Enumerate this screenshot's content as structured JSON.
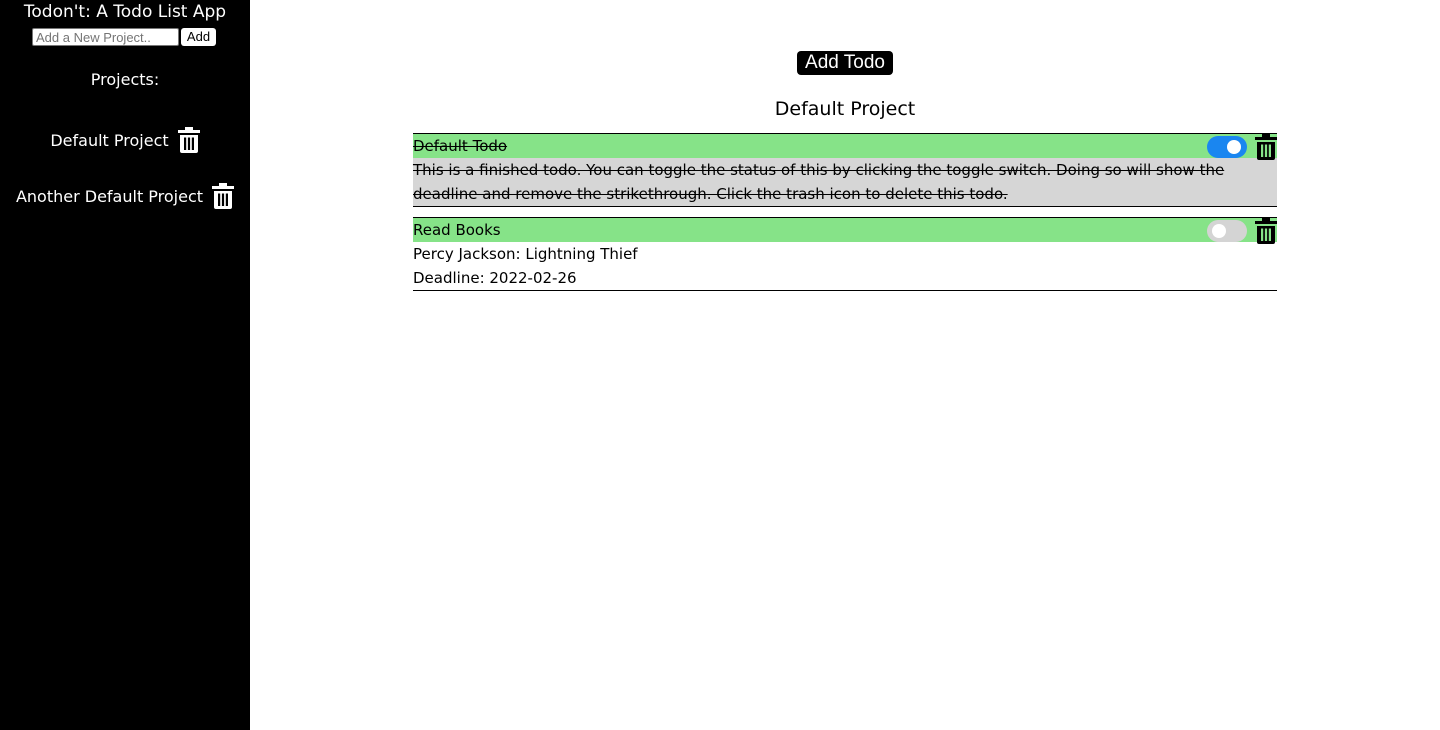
{
  "sidebar": {
    "app_title": "Todon't: A Todo List App",
    "new_project_placeholder": "Add a New Project..",
    "add_button_label": "Add",
    "projects_heading": "Projects:",
    "projects": [
      {
        "name": "Default Project",
        "icon": "trash-icon"
      },
      {
        "name": "Another Default Project",
        "icon": "trash-icon"
      }
    ]
  },
  "main": {
    "add_todo_label": "Add Todo",
    "project_title": "Default Project",
    "todos": [
      {
        "title": "Default Todo",
        "description": "This is a finished todo. You can toggle the status of this by clicking the toggle switch. Doing so will show the deadline and remove the strikethrough. Click the trash icon to delete this todo.",
        "completed": true
      },
      {
        "title": "Read Books",
        "description": "Percy Jackson: Lightning Thief",
        "deadline": "Deadline: 2022-02-26",
        "completed": false
      }
    ]
  },
  "colors": {
    "sidebar_bg": "#000000",
    "todo_header_bg": "#86e388",
    "completed_body_bg": "#d6d6d6",
    "toggle_on": "#1a86f0",
    "toggle_off": "#d4d4d4"
  }
}
